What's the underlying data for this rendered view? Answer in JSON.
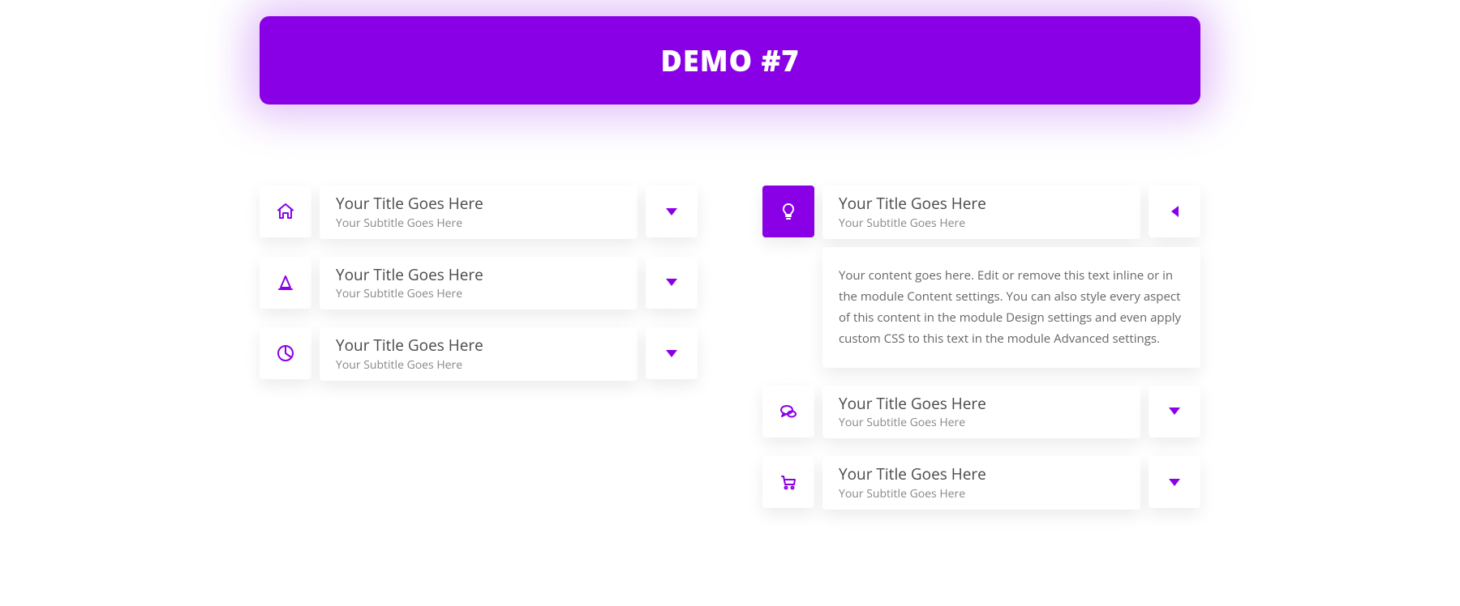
{
  "header": {
    "title": "DEMO #7"
  },
  "colors": {
    "accent": "#8a00e6"
  },
  "left_column": [
    {
      "icon": "house",
      "title": "Your Title Goes Here",
      "subtitle": "Your Subtitle Goes Here",
      "open": false
    },
    {
      "icon": "cone",
      "title": "Your Title Goes Here",
      "subtitle": "Your Subtitle Goes Here",
      "open": false
    },
    {
      "icon": "pie-chart",
      "title": "Your Title Goes Here",
      "subtitle": "Your Subtitle Goes Here",
      "open": false
    }
  ],
  "right_column": [
    {
      "icon": "lightbulb",
      "title": "Your Title Goes Here",
      "subtitle": "Your Subtitle Goes Here",
      "open": true,
      "content": "Your content goes here. Edit or remove this text inline or in the module Content settings. You can also style every aspect of this content in the module Design settings and even apply custom CSS to this text in the module Advanced settings."
    },
    {
      "icon": "chat",
      "title": "Your Title Goes Here",
      "subtitle": "Your Subtitle Goes Here",
      "open": false
    },
    {
      "icon": "cart",
      "title": "Your Title Goes Here",
      "subtitle": "Your Subtitle Goes Here",
      "open": false
    }
  ]
}
